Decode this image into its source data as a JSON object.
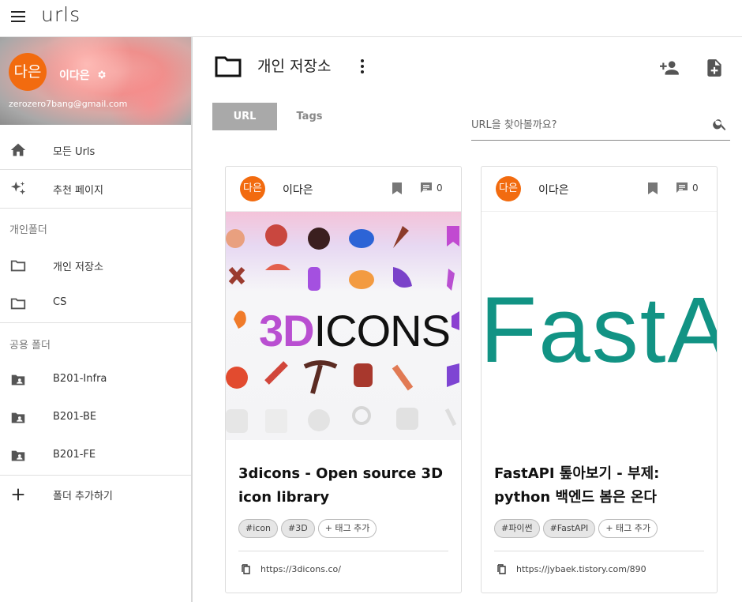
{
  "app": {
    "logo": "urls"
  },
  "profile": {
    "avatar_text": "다은",
    "name": "이다은",
    "email": "zerozero7bang@gmail.com"
  },
  "sidebar": {
    "main_items": [
      {
        "label": "모든 Urls",
        "icon": "home-icon"
      },
      {
        "label": "추천 페이지",
        "icon": "sparkle-icon"
      }
    ],
    "personal_header": "개인폴더",
    "personal_folders": [
      {
        "label": "개인 저장소",
        "icon": "folder-icon"
      },
      {
        "label": "CS",
        "icon": "folder-icon"
      }
    ],
    "shared_header": "공용 폴더",
    "shared_folders": [
      {
        "label": "B201-Infra",
        "icon": "shared-folder-icon"
      },
      {
        "label": "B201-BE",
        "icon": "shared-folder-icon"
      },
      {
        "label": "B201-FE",
        "icon": "shared-folder-icon"
      }
    ],
    "add_folder": "폴더 추가하기"
  },
  "main": {
    "title": "개인 저장소",
    "tabs": [
      {
        "label": "URL",
        "active": true
      },
      {
        "label": "Tags",
        "active": false
      }
    ],
    "search_placeholder": "URL을 찾아볼까요?"
  },
  "cards": [
    {
      "avatar_text": "다은",
      "author": "이다은",
      "comment_count": "0",
      "title": "3dicons - Open source 3D icon library",
      "tags": [
        "#icon",
        "#3D"
      ],
      "add_tag": "+ 태그 추가",
      "url": "https://3dicons.co/",
      "thumb_three": "3D",
      "thumb_rest": "ICONS"
    },
    {
      "avatar_text": "다은",
      "author": "이다은",
      "comment_count": "0",
      "title": "FastAPI 톺아보기 - 부제: python 백엔드 봄은 온다",
      "tags": [
        "#파이썬",
        "#FastAPI"
      ],
      "add_tag": "+ 태그 추가",
      "url": "https://jybaek.tistory.com/890",
      "thumb_text": "FastA"
    }
  ],
  "colors": {
    "avatar": "#f26b0f",
    "fastapi": "#129384",
    "tab_active": "#a9a9a9"
  }
}
